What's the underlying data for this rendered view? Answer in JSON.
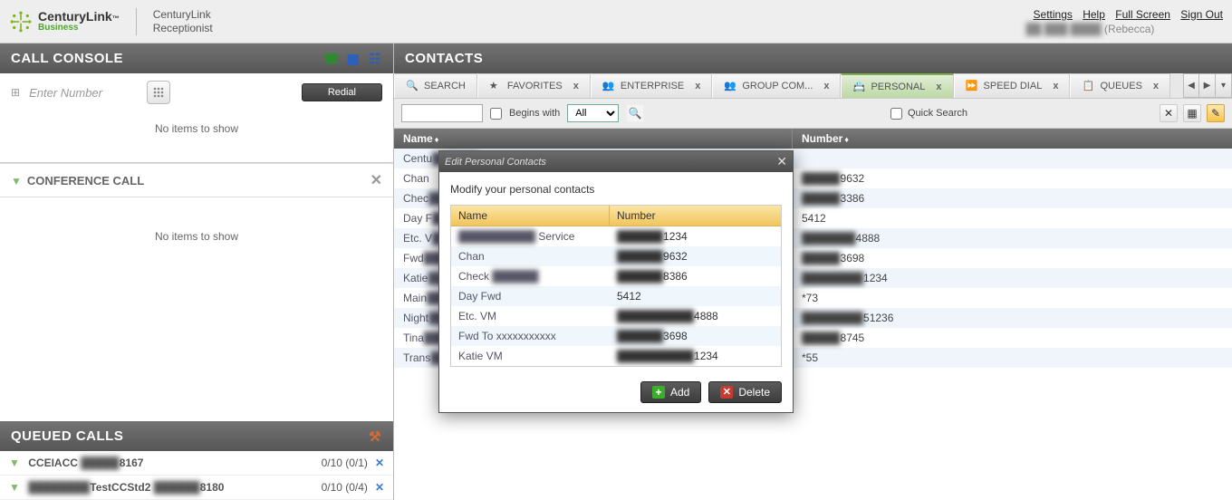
{
  "brand": {
    "name": "CenturyLink",
    "sub": "Business",
    "app1": "CenturyLink",
    "app2": "Receptionist"
  },
  "toplinks": {
    "settings": "Settings",
    "help": "Help",
    "fullscreen": "Full Screen",
    "signout": "Sign Out"
  },
  "user": {
    "hidden": "██ ███ ████",
    "name": "(Rebecca)"
  },
  "callConsole": {
    "title": "CALL CONSOLE",
    "placeholder": "Enter Number",
    "redial": "Redial",
    "empty": "No items to show"
  },
  "conference": {
    "title": "CONFERENCE CALL",
    "empty": "No items to show"
  },
  "queued": {
    "title": "QUEUED CALLS",
    "rows": [
      {
        "prefix": "CCEIACC",
        "hidden": "█████",
        "suffix": "8167",
        "counts": "0/10 (0/1)"
      },
      {
        "prefix": "",
        "hidden": "████████",
        "mid": "TestCCStd2",
        "hidden2": "██████",
        "suffix": "8180",
        "counts": "0/10 (0/4)"
      }
    ]
  },
  "contacts": {
    "title": "CONTACTS",
    "tabs": {
      "search": "SEARCH",
      "favorites": "FAVORITES",
      "enterprise": "ENTERPRISE",
      "groupcom": "GROUP COM...",
      "personal": "PERSONAL",
      "speeddial": "SPEED DIAL",
      "queues": "QUEUES"
    },
    "filter": {
      "begins": "Begins with",
      "all": "All",
      "quick": "Quick Search"
    },
    "columns": {
      "name": "Name",
      "number": "Number"
    },
    "rows": [
      {
        "namePrefix": "Centu",
        "nameHidden": "██████",
        "nameSuffix": "Service",
        "numHidden": "",
        "numSuffix": ""
      },
      {
        "namePrefix": "Chan",
        "nameHidden": "",
        "nameSuffix": "",
        "numHidden": "█████",
        "numSuffix": "9632"
      },
      {
        "namePrefix": "Chec",
        "nameHidden": "██████",
        "nameSuffix": "",
        "numHidden": "█████",
        "numSuffix": "3386"
      },
      {
        "namePrefix": "Day F",
        "nameHidden": "███",
        "nameSuffix": "",
        "numHidden": "",
        "numSuffix": "5412"
      },
      {
        "namePrefix": "Etc. V",
        "nameHidden": "██",
        "nameSuffix": "",
        "numHidden": "███████",
        "numSuffix": "4888"
      },
      {
        "namePrefix": "Fwd",
        "nameHidden": "████████████",
        "nameSuffix": "",
        "numHidden": "█████",
        "numSuffix": "3698"
      },
      {
        "namePrefix": "Katie",
        "nameHidden": "███",
        "nameSuffix": "",
        "numHidden": "████████",
        "numSuffix": "1234"
      },
      {
        "namePrefix": "Main",
        "nameHidden": "████",
        "nameSuffix": "",
        "numHidden": "",
        "numSuffix": "*73"
      },
      {
        "namePrefix": "Night",
        "nameHidden": "████",
        "nameSuffix": "",
        "numHidden": "████████",
        "numSuffix": "51236"
      },
      {
        "namePrefix": "Tina",
        "nameHidden": "███",
        "nameSuffix": "",
        "numHidden": "█████",
        "numSuffix": "8745"
      },
      {
        "namePrefix": "Trans",
        "nameHidden": "████",
        "nameSuffix": "",
        "numHidden": "",
        "numSuffix": "*55"
      }
    ]
  },
  "modal": {
    "title": "Edit Personal Contacts",
    "msg": "Modify your personal contacts",
    "columns": {
      "name": "Name",
      "number": "Number"
    },
    "rows": [
      {
        "nameHidden": "██████████",
        "nameSuffix": " Service",
        "numHidden": "██████",
        "numSuffix": "1234"
      },
      {
        "nameHidden": "",
        "nameSuffix": "Chan",
        "numHidden": "██████",
        "numSuffix": "9632"
      },
      {
        "nameHidden": "",
        "nameSuffix": "Check ",
        "nameHidden2": "██████",
        "numHidden": "██████",
        "numSuffix": "8386"
      },
      {
        "nameHidden": "",
        "nameSuffix": "Day Fwd",
        "numHidden": "",
        "numSuffix": "5412"
      },
      {
        "nameHidden": "",
        "nameSuffix": "Etc. VM",
        "numHidden": "██████████",
        "numSuffix": "4888"
      },
      {
        "nameHidden": "",
        "nameSuffix": "Fwd To xxxxxxxxxxx",
        "numHidden": "██████",
        "numSuffix": "3698"
      },
      {
        "nameHidden": "",
        "nameSuffix": "Katie VM",
        "numHidden": "██████████",
        "numSuffix": "1234"
      }
    ],
    "add": "Add",
    "delete": "Delete"
  }
}
